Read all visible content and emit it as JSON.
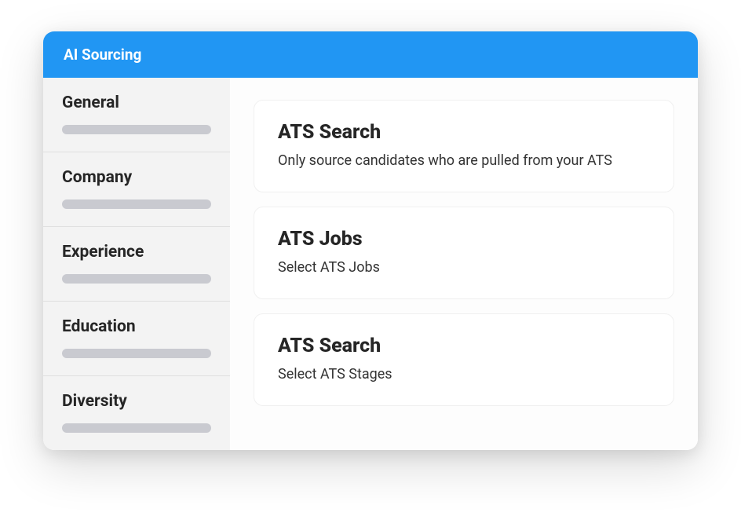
{
  "header": {
    "title": "AI Sourcing"
  },
  "sidebar": {
    "items": [
      {
        "label": "General"
      },
      {
        "label": "Company"
      },
      {
        "label": "Experience"
      },
      {
        "label": "Education"
      },
      {
        "label": "Diversity"
      }
    ]
  },
  "main": {
    "cards": [
      {
        "title": "ATS Search",
        "description": "Only source candidates who are pulled from your ATS"
      },
      {
        "title": "ATS Jobs",
        "description": "Select ATS Jobs"
      },
      {
        "title": "ATS Search",
        "description": "Select ATS Stages"
      }
    ]
  }
}
